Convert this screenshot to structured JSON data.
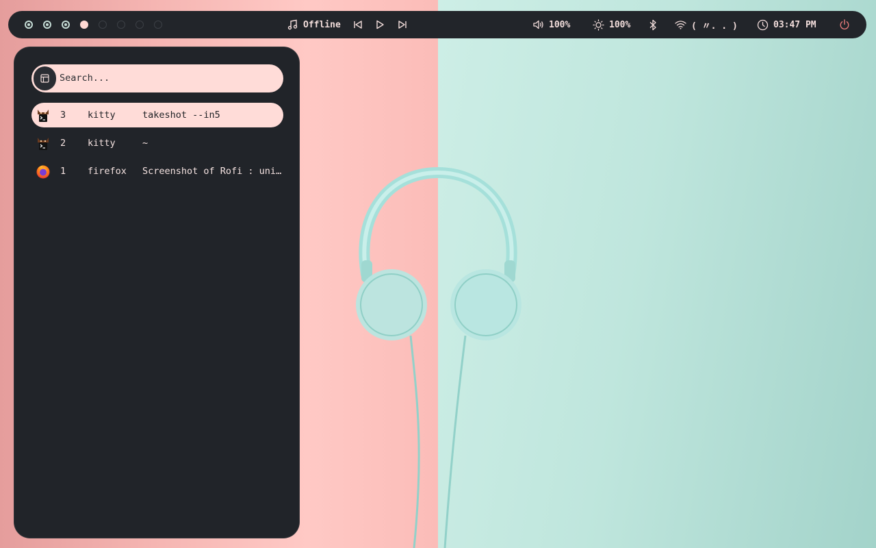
{
  "bar": {
    "workspaces": [
      {
        "id": 1,
        "state": "occupied"
      },
      {
        "id": 2,
        "state": "occupied"
      },
      {
        "id": 3,
        "state": "occupied"
      },
      {
        "id": 4,
        "state": "active"
      },
      {
        "id": 5,
        "state": "empty"
      },
      {
        "id": 6,
        "state": "empty"
      },
      {
        "id": 7,
        "state": "empty"
      },
      {
        "id": 8,
        "state": "empty"
      }
    ],
    "music": {
      "icon": "music-note-icon",
      "status": "Offline"
    },
    "volume": {
      "icon": "speaker-icon",
      "value": "100%"
    },
    "brightness": {
      "icon": "sun-icon",
      "value": "100%"
    },
    "bluetooth": {
      "icon": "bluetooth-icon"
    },
    "network": {
      "icon": "wifi-icon",
      "value": "( 〃. . )"
    },
    "clock": {
      "icon": "clock-icon",
      "time": "03:47 PM"
    },
    "power": {
      "icon": "power-icon",
      "color": "#e57a7a"
    }
  },
  "launcher": {
    "search_placeholder": "Search...",
    "mode_icon": "window-icon",
    "windows": [
      {
        "number": "3",
        "class": "kitty",
        "title": "takeshot --in5",
        "icon": "kitty-icon",
        "selected": true
      },
      {
        "number": "2",
        "class": "kitty",
        "title": "~",
        "icon": "kitty-icon",
        "selected": false
      },
      {
        "number": "1",
        "class": "firefox",
        "title": "Screenshot of Rofi : unixporn",
        "icon": "firefox-icon",
        "selected": false
      }
    ]
  },
  "colors": {
    "bar_bg": "#22252a",
    "accent_pink": "#ffdcd8",
    "accent_mint": "#c6ddd6",
    "launcher_bg": "#212429"
  }
}
